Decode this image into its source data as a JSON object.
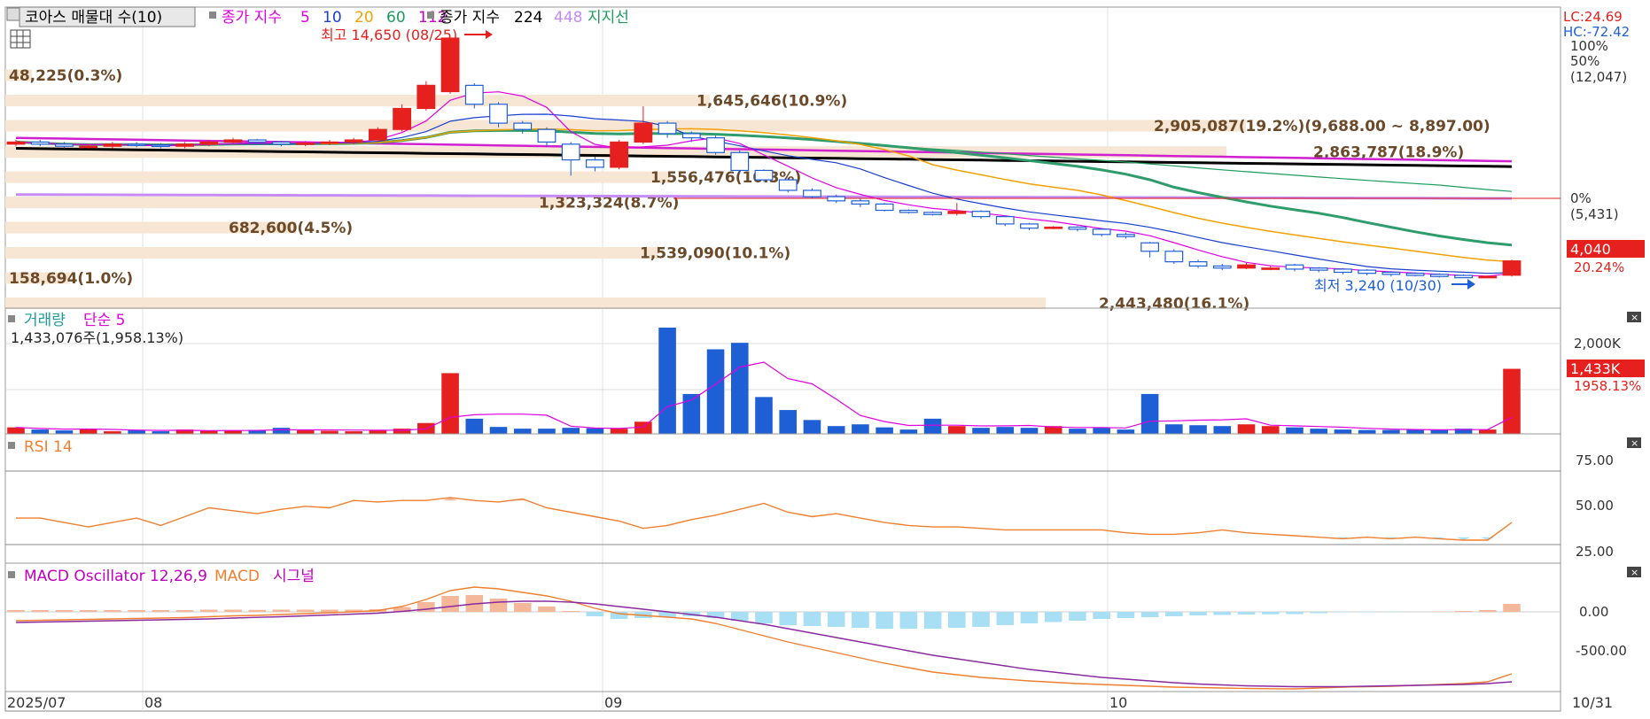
{
  "header": {
    "title": "코아스 매물대 수(10)",
    "ma_label": "종가 지수",
    "ma_periods": [
      "5",
      "10",
      "20",
      "60",
      "112"
    ],
    "ma_colors": [
      "#e000e0",
      "#1a3fcf",
      "#f2a100",
      "#1e9c5c",
      "#c000c0"
    ],
    "ma2_label": "종가 지수",
    "ma2_periods": [
      "224",
      "448"
    ],
    "ma2_colors": [
      "#000000",
      "#c58cf5"
    ],
    "support_label": "지지선",
    "support_color": "#1e9c5c"
  },
  "price_panel": {
    "lc": "LC:24.69",
    "hc": "HC:-72.42",
    "high_marker": "최고 14,650 (08/25)",
    "low_marker": "최저 3,240 (10/30)",
    "pct_labels": [
      "100%",
      "50%",
      "(12,047)",
      "0%",
      "(5,431)"
    ],
    "current_price": "4,040",
    "current_change": "20.24%"
  },
  "volume_profile": [
    {
      "price_low": 12600,
      "price_high": 13150,
      "label": "48,225(0.3%)"
    },
    {
      "price_low": 11400,
      "price_high": 11950,
      "label": "1,645,646(10.9%)"
    },
    {
      "price_low": 10200,
      "price_high": 10750,
      "label": "2,905,087(19.2%)(9,688.00 ~ 8,897.00)"
    },
    {
      "price_low": 8950,
      "price_high": 9500,
      "label": "2,863,787(18.9%)"
    },
    {
      "price_low": 7750,
      "price_high": 8300,
      "label": "1,556,476(10.3%)"
    },
    {
      "price_low": 6550,
      "price_high": 7100,
      "label": "1,323,324(8.7%)"
    },
    {
      "price_low": 5350,
      "price_high": 5900,
      "label": "682,600(4.5%)"
    },
    {
      "price_low": 4150,
      "price_high": 4700,
      "label": "1,539,090(10.1%)"
    },
    {
      "price_low": 2950,
      "price_high": 3500,
      "label": "158,694(1.0%)"
    },
    {
      "price_low": 1750,
      "price_high": 2300,
      "label": "2,443,480(16.1%)"
    }
  ],
  "volume_panel": {
    "title": "거래량",
    "ma_label": "단순 5",
    "summary": "1,433,076주(1,958.13%)",
    "axis_label": "2,000K",
    "current_value": "1,433K",
    "current_change": "1958.13%"
  },
  "rsi_panel": {
    "title": "RSI 14",
    "ticks": [
      "75.00",
      "50.00",
      "25.00"
    ]
  },
  "macd_panel": {
    "title": "MACD Oscillator 12,26,9",
    "macd_label": "MACD",
    "signal_label": "시그널",
    "ticks": [
      "0.00",
      "-500.00"
    ]
  },
  "x_axis": {
    "labels": [
      "2025/07",
      "08",
      "09",
      "10"
    ],
    "end_label": "10/31"
  },
  "colors": {
    "up": "#e5201f",
    "down": "#1f5fd6",
    "profile": "#f7e6d3",
    "rsi": "#f07f2f",
    "macd_pos": "#f5b79a",
    "macd_neg": "#a9dff4"
  },
  "chart_data": {
    "type": "candlestick",
    "title": "코아스",
    "dates": [
      "07/29",
      "07/30",
      "07/31",
      "08/01",
      "08/04",
      "08/05",
      "08/06",
      "08/07",
      "08/08",
      "08/11",
      "08/12",
      "08/13",
      "08/14",
      "08/18",
      "08/19",
      "08/20",
      "08/21",
      "08/22",
      "08/25",
      "08/26",
      "08/27",
      "08/28",
      "08/29",
      "09/01",
      "09/02",
      "09/03",
      "09/04",
      "09/05",
      "09/08",
      "09/09",
      "09/10",
      "09/11",
      "09/12",
      "09/15",
      "09/16",
      "09/17",
      "09/18",
      "09/19",
      "09/22",
      "09/23",
      "09/24",
      "09/25",
      "09/26",
      "09/29",
      "09/30",
      "10/01",
      "10/02",
      "10/10",
      "10/13",
      "10/14",
      "10/15",
      "10/16",
      "10/17",
      "10/20",
      "10/21",
      "10/22",
      "10/23",
      "10/24",
      "10/27",
      "10/28",
      "10/29",
      "10/30",
      "10/31"
    ],
    "open": [
      9600,
      9700,
      9600,
      9500,
      9500,
      9600,
      9550,
      9500,
      9600,
      9700,
      9800,
      9700,
      9600,
      9650,
      9700,
      9800,
      10300,
      11300,
      12100,
      12400,
      11500,
      10600,
      10300,
      9600,
      8850,
      8500,
      9700,
      10600,
      10100,
      9900,
      9200,
      8350,
      7900,
      7400,
      7100,
      6900,
      6750,
      6450,
      6350,
      6300,
      6400,
      6150,
      5800,
      5600,
      5650,
      5550,
      5300,
      4900,
      4500,
      4000,
      3800,
      3700,
      3700,
      3850,
      3700,
      3650,
      3600,
      3500,
      3450,
      3400,
      3350,
      3300,
      3360
    ],
    "close": [
      9700,
      9600,
      9500,
      9500,
      9600,
      9550,
      9500,
      9600,
      9700,
      9800,
      9700,
      9600,
      9650,
      9700,
      9800,
      10300,
      11300,
      12400,
      14650,
      11500,
      10600,
      10300,
      9700,
      8850,
      8500,
      9700,
      10600,
      10100,
      9900,
      9200,
      8350,
      7900,
      7400,
      7100,
      6900,
      6750,
      6450,
      6350,
      6250,
      6400,
      6150,
      5800,
      5600,
      5650,
      5550,
      5300,
      5200,
      4500,
      4000,
      3800,
      3700,
      3850,
      3700,
      3650,
      3600,
      3500,
      3450,
      3400,
      3350,
      3300,
      3240,
      3300,
      4040
    ],
    "high": [
      9800,
      9800,
      9700,
      9600,
      9700,
      9700,
      9650,
      9700,
      9800,
      9900,
      9850,
      9750,
      9750,
      9800,
      9900,
      10400,
      11500,
      12600,
      14650,
      12500,
      11600,
      10700,
      10400,
      9700,
      9000,
      9800,
      11400,
      10700,
      10200,
      10000,
      9300,
      8400,
      8000,
      7500,
      7200,
      7000,
      6800,
      6500,
      6400,
      6800,
      6450,
      6200,
      5850,
      5700,
      5700,
      5600,
      5400,
      4950,
      4600,
      4100,
      3900,
      3950,
      3800,
      3900,
      3750,
      3700,
      3650,
      3550,
      3500,
      3450,
      3400,
      3350,
      4100
    ],
    "low": [
      9500,
      9500,
      9400,
      9400,
      9400,
      9450,
      9400,
      9400,
      9500,
      9600,
      9600,
      9500,
      9500,
      9550,
      9600,
      9700,
      10200,
      11200,
      12000,
      11300,
      10400,
      10100,
      9500,
      8100,
      8300,
      8400,
      9600,
      9900,
      9700,
      9100,
      8200,
      7800,
      7300,
      7000,
      6800,
      6600,
      6400,
      6300,
      6200,
      6200,
      6050,
      5700,
      5500,
      5550,
      5450,
      5200,
      5100,
      4200,
      3900,
      3700,
      3600,
      3650,
      3600,
      3550,
      3500,
      3400,
      3350,
      3300,
      3300,
      3250,
      3240,
      3240,
      3300
    ],
    "volume": [
      15,
      10,
      8,
      12,
      6,
      8,
      6,
      10,
      7,
      8,
      9,
      14,
      8,
      7,
      6,
      8,
      12,
      25,
      140,
      35,
      16,
      12,
      12,
      14,
      13,
      12,
      28,
      245,
      92,
      195,
      210,
      85,
      55,
      32,
      18,
      22,
      15,
      10,
      35,
      18,
      14,
      16,
      14,
      18,
      12,
      14,
      10,
      92,
      22,
      20,
      18,
      22,
      18,
      15,
      12,
      10,
      9,
      9,
      10,
      9,
      12,
      10,
      150
    ],
    "rsi": [
      43,
      43,
      40,
      37,
      40,
      43,
      38,
      44,
      50,
      48,
      46,
      49,
      51,
      50,
      55,
      54,
      55,
      55,
      57,
      55,
      54,
      56,
      50,
      47,
      44,
      41,
      36,
      38,
      42,
      45,
      49,
      53,
      47,
      44,
      46,
      43,
      40,
      38,
      37,
      37,
      36,
      35,
      35,
      35,
      35,
      35,
      33,
      32,
      32,
      33,
      35,
      33,
      32,
      31,
      30,
      29,
      30,
      29,
      30,
      29,
      28,
      28,
      40
    ],
    "macd": [
      -100,
      -95,
      -90,
      -85,
      -80,
      -75,
      -70,
      -65,
      -55,
      -45,
      -40,
      -30,
      -20,
      -10,
      0,
      15,
      60,
      140,
      240,
      280,
      260,
      220,
      180,
      120,
      40,
      -20,
      -40,
      -60,
      -80,
      -130,
      -200,
      -270,
      -340,
      -400,
      -460,
      -520,
      -580,
      -630,
      -680,
      -710,
      -740,
      -760,
      -780,
      -795,
      -810,
      -820,
      -830,
      -840,
      -850,
      -855,
      -860,
      -865,
      -868,
      -870,
      -860,
      -850,
      -845,
      -840,
      -830,
      -820,
      -810,
      -790,
      -700
    ],
    "signal": [
      -120,
      -115,
      -110,
      -105,
      -100,
      -95,
      -90,
      -85,
      -80,
      -70,
      -62,
      -55,
      -45,
      -35,
      -25,
      -15,
      5,
      30,
      60,
      90,
      110,
      120,
      120,
      110,
      90,
      60,
      30,
      0,
      -30,
      -60,
      -100,
      -140,
      -190,
      -240,
      -290,
      -340,
      -390,
      -440,
      -490,
      -530,
      -570,
      -610,
      -650,
      -680,
      -710,
      -740,
      -760,
      -780,
      -800,
      -815,
      -825,
      -835,
      -840,
      -845,
      -845,
      -845,
      -840,
      -835,
      -830,
      -825,
      -820,
      -810,
      -790
    ],
    "xlabel": "",
    "ylabel": ""
  }
}
